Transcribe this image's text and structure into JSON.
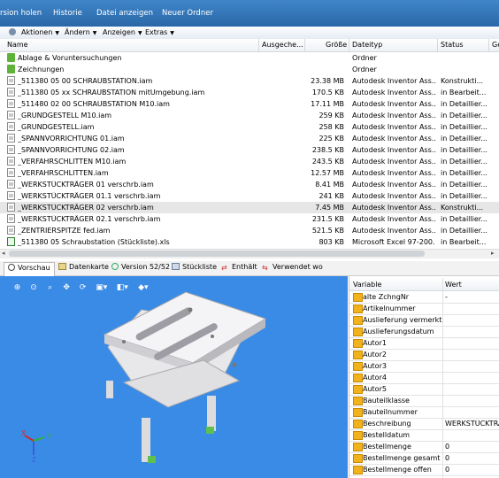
{
  "topbar": {
    "items": [
      "rsion holen",
      "Historie",
      "Datei anzeigen",
      "Neuer Ordner"
    ]
  },
  "toolbar": {
    "items": [
      "Aktionen",
      "Ändern",
      "Anzeigen",
      "Extras"
    ]
  },
  "file_list": {
    "columns": [
      "Name",
      "Ausgeche...",
      "Größe",
      "Dateityp",
      "Status",
      "Ge"
    ],
    "rows": [
      {
        "name": "Ablage & Voruntersuchungen",
        "size": "",
        "type": "Ordner",
        "status": "",
        "icon": "folder"
      },
      {
        "name": "Zeichnungen",
        "size": "",
        "type": "Ordner",
        "status": "",
        "icon": "folder"
      },
      {
        "name": "_511380 05 00 SCHRAUBSTATION.iam",
        "size": "23.38 MB",
        "type": "Autodesk Inventor Ass...",
        "status": "Konstrukti...",
        "icon": "iam"
      },
      {
        "name": "_511380 05 xx SCHRAUBSTATION mitUmgebung.iam",
        "size": "170.5 KB",
        "type": "Autodesk Inventor Ass...",
        "status": "in Bearbeit...",
        "icon": "iam"
      },
      {
        "name": "_511480 02 00 SCHRAUBSTATION M10.iam",
        "size": "17.11 MB",
        "type": "Autodesk Inventor Ass...",
        "status": "in Detaillier...",
        "icon": "iam"
      },
      {
        "name": "_GRUNDGESTELL M10.iam",
        "size": "259 KB",
        "type": "Autodesk Inventor Ass...",
        "status": "in Detaillier...",
        "icon": "iam"
      },
      {
        "name": "_GRUNDGESTELL.iam",
        "size": "258 KB",
        "type": "Autodesk Inventor Ass...",
        "status": "in Detaillier...",
        "icon": "iam"
      },
      {
        "name": "_SPANNVORRICHTUNG 01.iam",
        "size": "225 KB",
        "type": "Autodesk Inventor Ass...",
        "status": "in Detaillier...",
        "icon": "iam"
      },
      {
        "name": "_SPANNVORRICHTUNG 02.iam",
        "size": "238.5 KB",
        "type": "Autodesk Inventor Ass...",
        "status": "in Detaillier...",
        "icon": "iam"
      },
      {
        "name": "_VERFAHRSCHLITTEN M10.iam",
        "size": "243.5 KB",
        "type": "Autodesk Inventor Ass...",
        "status": "in Detaillier...",
        "icon": "iam"
      },
      {
        "name": "_VERFAHRSCHLITTEN.iam",
        "size": "12.57 MB",
        "type": "Autodesk Inventor Ass...",
        "status": "in Detaillier...",
        "icon": "iam"
      },
      {
        "name": "_WERKSTÜCKTRÄGER 01 verschrb.iam",
        "size": "8.41 MB",
        "type": "Autodesk Inventor Ass...",
        "status": "in Detaillier...",
        "icon": "iam"
      },
      {
        "name": "_WERKSTÜCKTRÄGER 01.1 verschrb.iam",
        "size": "241 KB",
        "type": "Autodesk Inventor Ass...",
        "status": "in Detaillier...",
        "icon": "iam"
      },
      {
        "name": "_WERKSTÜCKTRÄGER 02 verschrb.iam",
        "size": "7.45 MB",
        "type": "Autodesk Inventor Ass...",
        "status": "Konstrukti...",
        "icon": "iam",
        "selected": true
      },
      {
        "name": "_WERKSTÜCKTRÄGER 02.1 verschrb.iam",
        "size": "231.5 KB",
        "type": "Autodesk Inventor Ass...",
        "status": "in Detaillier...",
        "icon": "iam"
      },
      {
        "name": "_ZENTRIERSPITZE fed.iam",
        "size": "521.5 KB",
        "type": "Autodesk Inventor Ass...",
        "status": "in Detaillier...",
        "icon": "iam"
      },
      {
        "name": "_511380 05 Schraubstation (Stückliste).xls",
        "size": "803 KB",
        "type": "Microsoft Excel 97-200...",
        "status": "in Bearbeit...",
        "icon": "xls"
      }
    ]
  },
  "tabs": [
    {
      "label": "Vorschau",
      "icon": "search-icon",
      "active": true
    },
    {
      "label": "Datenkarte",
      "icon": "card-icon"
    },
    {
      "label": "Version 52/52",
      "icon": "clock-icon"
    },
    {
      "label": "Stückliste",
      "icon": "list-icon"
    },
    {
      "label": "Enthält",
      "icon": "link-icon"
    },
    {
      "label": "Verwendet wo",
      "icon": "arrow-icon"
    }
  ],
  "preview": {
    "tools": [
      "zoom-in-icon",
      "zoom-icon",
      "zoom-window-icon",
      "pan-icon",
      "rotate-icon",
      "view-cube-icon",
      "section-icon",
      "shading-icon"
    ],
    "axes": {
      "x": "X",
      "y": "Y",
      "z": "Z"
    }
  },
  "properties": {
    "columns": [
      "Variable",
      "Wert"
    ],
    "rows": [
      {
        "name": "alte ZchngNr",
        "value": "-"
      },
      {
        "name": "Artikelnummer",
        "value": ""
      },
      {
        "name": "Auslieferung vermerkt...",
        "value": ""
      },
      {
        "name": "Auslieferungsdatum",
        "value": ""
      },
      {
        "name": "Autor1",
        "value": ""
      },
      {
        "name": "Autor2",
        "value": ""
      },
      {
        "name": "Autor3",
        "value": ""
      },
      {
        "name": "Autor4",
        "value": ""
      },
      {
        "name": "Autor5",
        "value": ""
      },
      {
        "name": "Bauteilklasse",
        "value": ""
      },
      {
        "name": "Bauteilnummer",
        "value": ""
      },
      {
        "name": "Beschreibung",
        "value": "WERKSTÜCKTRÄ"
      },
      {
        "name": "Bestelldatum",
        "value": ""
      },
      {
        "name": "Bestellmenge",
        "value": "0"
      },
      {
        "name": "Bestellmenge gesamt",
        "value": "0"
      },
      {
        "name": "Bestellmenge offen",
        "value": "0"
      }
    ]
  }
}
